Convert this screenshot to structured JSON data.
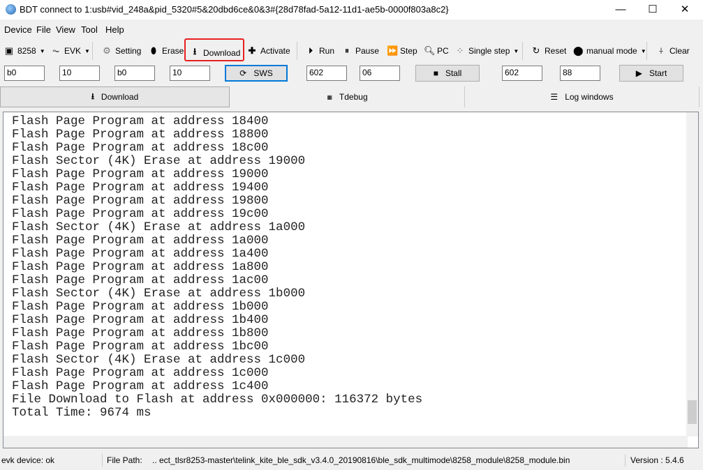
{
  "window": {
    "title": "BDT connect to 1:usb#vid_248a&pid_5320#5&20dbd6ce&0&3#{28d78fad-5a12-11d1-ae5b-0000f803a8c2}",
    "minimize": "—",
    "maximize": "☐",
    "close": "✕"
  },
  "menu": [
    "Device",
    "File",
    "View",
    "Tool",
    "Help"
  ],
  "toolbar": {
    "chip": "8258",
    "board": "EVK",
    "setting": "Setting",
    "erase": "Erase",
    "download": "Download",
    "activate": "Activate",
    "run": "Run",
    "pause": "Pause",
    "step": "Step",
    "pc": "PC",
    "single_step": "Single step",
    "reset": "Reset",
    "mode": "manual mode",
    "clear": "Clear"
  },
  "fields": {
    "f1": "b0",
    "f2": "10",
    "f3": "b0",
    "f4": "10",
    "sws": "SWS",
    "f5": "602",
    "f6": "06",
    "stall": "Stall",
    "f7": "602",
    "f8": "88",
    "start": "Start"
  },
  "tabs": [
    "Download",
    "Tdebug",
    "Log windows"
  ],
  "log": [
    "Flash Page Program at address 18400",
    "Flash Page Program at address 18800",
    "Flash Page Program at address 18c00",
    "Flash Sector (4K) Erase at address 19000",
    "Flash Page Program at address 19000",
    "Flash Page Program at address 19400",
    "Flash Page Program at address 19800",
    "Flash Page Program at address 19c00",
    "Flash Sector (4K) Erase at address 1a000",
    "Flash Page Program at address 1a000",
    "Flash Page Program at address 1a400",
    "Flash Page Program at address 1a800",
    "Flash Page Program at address 1ac00",
    "Flash Sector (4K) Erase at address 1b000",
    "Flash Page Program at address 1b000",
    "Flash Page Program at address 1b400",
    "Flash Page Program at address 1b800",
    "Flash Page Program at address 1bc00",
    "Flash Sector (4K) Erase at address 1c000",
    "Flash Page Program at address 1c000",
    "Flash Page Program at address 1c400",
    "File Download to Flash at address 0x000000: 116372 bytes",
    "Total Time: 9674 ms"
  ],
  "status": {
    "device": "evk device: ok",
    "file_label": "File Path:",
    "file_path": "..  ect_tlsr8253-master\\telink_kite_ble_sdk_v3.4.0_20190816\\ble_sdk_multimode\\8258_module\\8258_module.bin",
    "version": "Version : 5.4.6"
  },
  "colors": {
    "highlight": "#e8201f",
    "focus": "#0078d7"
  }
}
